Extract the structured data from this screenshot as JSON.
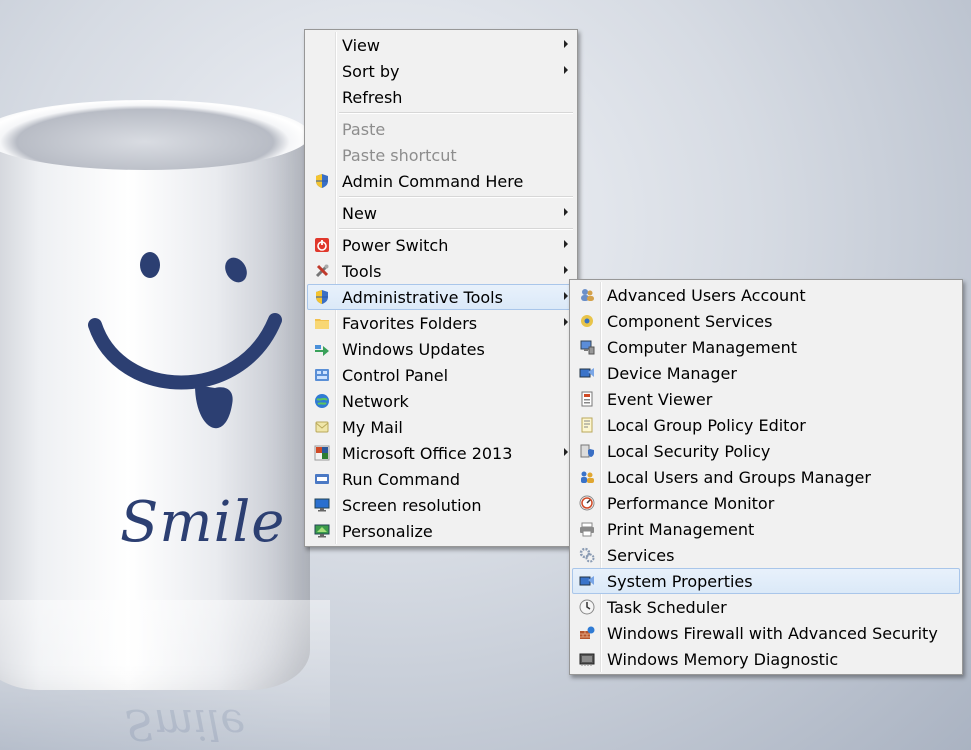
{
  "wallpaper": {
    "cup_text": "Smile"
  },
  "context_menu": {
    "items": [
      {
        "label": "View",
        "submenu": true
      },
      {
        "label": "Sort by",
        "submenu": true
      },
      {
        "label": "Refresh"
      },
      {
        "label": "Paste",
        "disabled": true
      },
      {
        "label": "Paste shortcut",
        "disabled": true
      },
      {
        "label": "Admin Command Here",
        "icon": "uac-shield-icon"
      },
      {
        "label": "New",
        "submenu": true
      },
      {
        "label": "Power Switch",
        "icon": "power-icon",
        "submenu": true
      },
      {
        "label": "Tools",
        "icon": "tools-icon",
        "submenu": true
      },
      {
        "label": "Administrative Tools",
        "icon": "uac-shield-icon",
        "submenu": true,
        "highlighted": true
      },
      {
        "label": "Favorites Folders",
        "icon": "folder-icon",
        "submenu": true
      },
      {
        "label": "Windows Updates",
        "icon": "windows-update-icon"
      },
      {
        "label": "Control Panel",
        "icon": "control-panel-icon"
      },
      {
        "label": "Network",
        "icon": "network-icon"
      },
      {
        "label": "My Mail",
        "icon": "mail-icon"
      },
      {
        "label": "Microsoft Office 2013",
        "icon": "office-icon",
        "submenu": true
      },
      {
        "label": "Run Command",
        "icon": "run-icon"
      },
      {
        "label": "Screen resolution",
        "icon": "monitor-icon"
      },
      {
        "label": "Personalize",
        "icon": "personalize-icon"
      }
    ]
  },
  "admin_submenu": {
    "items": [
      {
        "label": "Advanced Users Account",
        "icon": "users-icon"
      },
      {
        "label": "Component Services",
        "icon": "component-services-icon"
      },
      {
        "label": "Computer Management",
        "icon": "computer-management-icon"
      },
      {
        "label": "Device Manager",
        "icon": "device-manager-icon"
      },
      {
        "label": "Event Viewer",
        "icon": "event-viewer-icon"
      },
      {
        "label": "Local Group Policy Editor",
        "icon": "policy-editor-icon"
      },
      {
        "label": "Local Security Policy",
        "icon": "security-policy-icon"
      },
      {
        "label": "Local Users and Groups Manager",
        "icon": "users-groups-icon"
      },
      {
        "label": "Performance Monitor",
        "icon": "performance-monitor-icon"
      },
      {
        "label": "Print Management",
        "icon": "printer-icon"
      },
      {
        "label": "Services",
        "icon": "services-gear-icon"
      },
      {
        "label": "System Properties",
        "icon": "system-properties-icon",
        "highlighted": true
      },
      {
        "label": "Task Scheduler",
        "icon": "clock-icon"
      },
      {
        "label": "Windows Firewall with Advanced Security",
        "icon": "firewall-icon"
      },
      {
        "label": "Windows Memory Diagnostic",
        "icon": "memory-chip-icon"
      }
    ]
  },
  "colors": {
    "menu_bg": "#f1f1f1",
    "highlight_bg": "#dbe9f8",
    "highlight_border": "#a9c6ea",
    "disabled_text": "#8d8d8d",
    "smile_ink": "#2c3f72"
  }
}
